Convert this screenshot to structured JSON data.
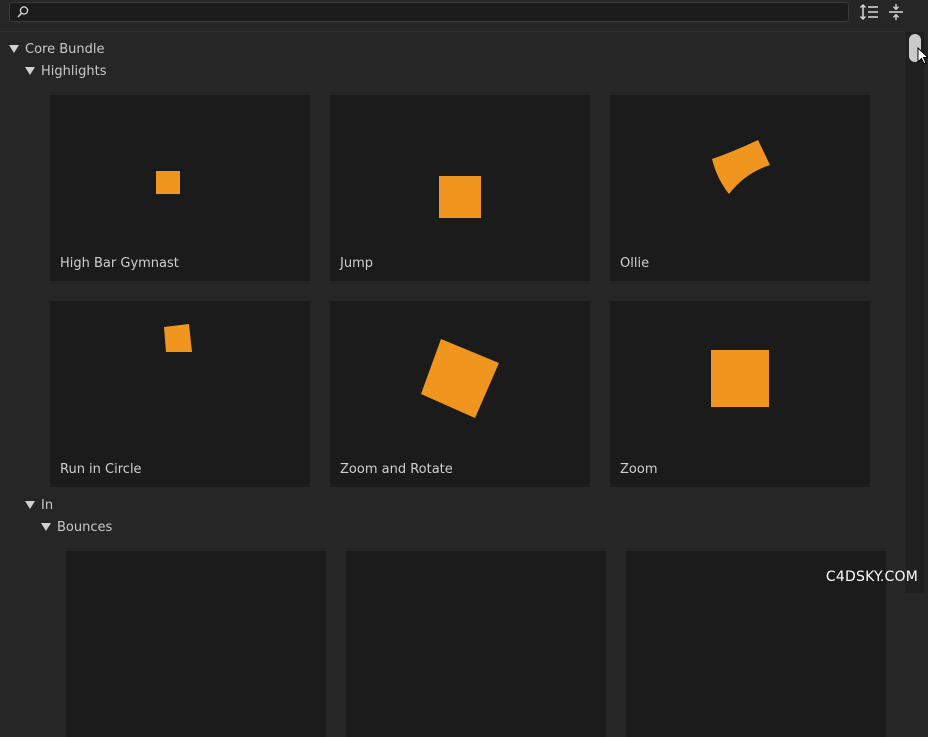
{
  "search": {
    "value": "",
    "placeholder": ""
  },
  "toolbar": {
    "expand_icon": "expand-all-icon",
    "collapse_icon": "collapse-all-icon"
  },
  "tree": {
    "root_label": "Core Bundle",
    "highlights_label": "Highlights",
    "in_label": "In",
    "bounces_label": "Bounces"
  },
  "highlights": [
    {
      "label": "High Bar Gymnast"
    },
    {
      "label": "Jump"
    },
    {
      "label": "Ollie"
    },
    {
      "label": "Run in Circle"
    },
    {
      "label": "Zoom and Rotate"
    },
    {
      "label": "Zoom"
    }
  ],
  "colors": {
    "accent": "#f0961e",
    "tile_bg": "#1b1b1b",
    "panel_bg": "#262626"
  },
  "watermark": "C4DSKY.COM"
}
